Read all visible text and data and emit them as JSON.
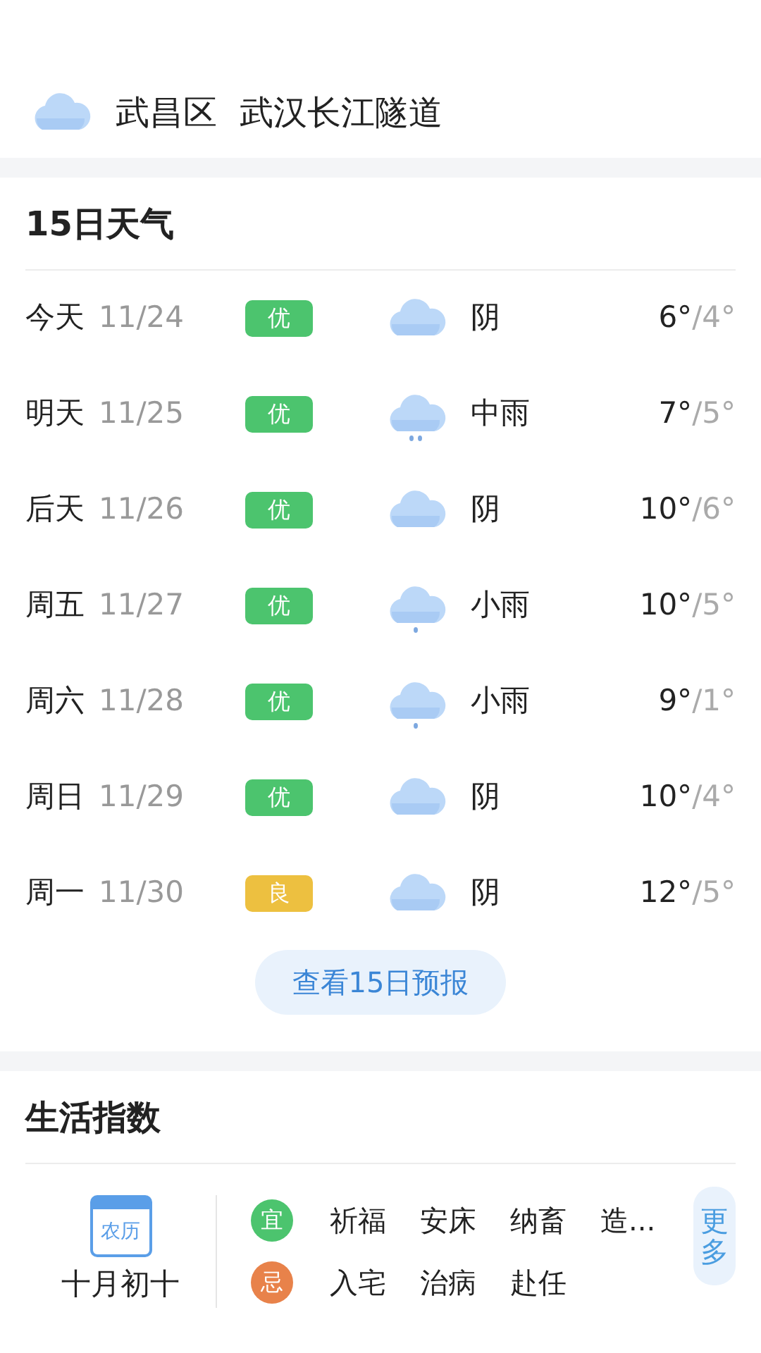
{
  "location": {
    "district": "武昌区",
    "place": "武汉长江隧道"
  },
  "forecast": {
    "title": "15日天气",
    "days": [
      {
        "day": "今天",
        "date": "11/24",
        "aqi": {
          "label": "优",
          "color": "#4cc46e"
        },
        "kind": "cloudy",
        "weather": "阴",
        "high": "6°",
        "low": "/4°"
      },
      {
        "day": "明天",
        "date": "11/25",
        "aqi": {
          "label": "优",
          "color": "#4cc46e"
        },
        "kind": "moderate-rain",
        "weather": "中雨",
        "high": "7°",
        "low": "/5°"
      },
      {
        "day": "后天",
        "date": "11/26",
        "aqi": {
          "label": "优",
          "color": "#4cc46e"
        },
        "kind": "cloudy",
        "weather": "阴",
        "high": "10°",
        "low": "/6°"
      },
      {
        "day": "周五",
        "date": "11/27",
        "aqi": {
          "label": "优",
          "color": "#4cc46e"
        },
        "kind": "light-rain",
        "weather": "小雨",
        "high": "10°",
        "low": "/5°"
      },
      {
        "day": "周六",
        "date": "11/28",
        "aqi": {
          "label": "优",
          "color": "#4cc46e"
        },
        "kind": "light-rain",
        "weather": "小雨",
        "high": "9°",
        "low": "/1°"
      },
      {
        "day": "周日",
        "date": "11/29",
        "aqi": {
          "label": "优",
          "color": "#4cc46e"
        },
        "kind": "cloudy",
        "weather": "阴",
        "high": "10°",
        "low": "/4°"
      },
      {
        "day": "周一",
        "date": "11/30",
        "aqi": {
          "label": "良",
          "color": "#edc040"
        },
        "kind": "cloudy",
        "weather": "阴",
        "high": "12°",
        "low": "/5°"
      }
    ],
    "more_button": "查看15日预报"
  },
  "life_index": {
    "title": "生活指数",
    "calendar_icon_label": "农历",
    "lunar_date": "十月初十",
    "rows": [
      {
        "kind": "good",
        "mark": "宜",
        "items": [
          "祈福",
          "安床",
          "纳畜",
          "造..."
        ]
      },
      {
        "kind": "bad",
        "mark": "忌",
        "items": [
          "入宅",
          "治病",
          "赴任"
        ]
      }
    ],
    "more_button": "更多"
  }
}
